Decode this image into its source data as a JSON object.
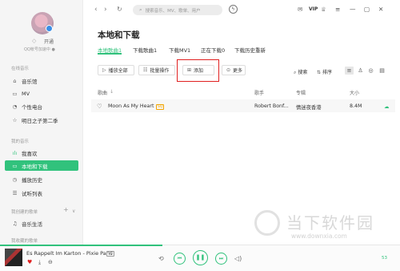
{
  "user": {
    "vip_open": "开通",
    "qq_hint": "QQ帐号加速中 ●"
  },
  "sidebar": {
    "online_heading": "在线音乐",
    "online_items": [
      {
        "label": "音乐馆",
        "icon": "music-hall-icon"
      },
      {
        "label": "MV",
        "icon": "mv-icon"
      },
      {
        "label": "个性电台",
        "icon": "radio-icon"
      },
      {
        "label": "明日之子第二季",
        "icon": "star-icon"
      }
    ],
    "my_heading": "我的音乐",
    "my_items": [
      {
        "label": "我喜欢",
        "icon": "love-chart-icon"
      },
      {
        "label": "本地和下载",
        "icon": "local-download-icon",
        "active": true
      },
      {
        "label": "播放历史",
        "icon": "history-icon"
      },
      {
        "label": "试听列表",
        "icon": "playlist-icon"
      }
    ],
    "created_heading": "我创建的歌单",
    "created_items": [
      {
        "label": "音乐生活",
        "icon": "playlist-music-icon"
      }
    ],
    "collected_heading": "我收藏的歌单"
  },
  "topbar": {
    "search_placeholder": "搜索音乐、MV、歌单、用户",
    "vip_label": "VIP"
  },
  "main": {
    "title": "本地和下载",
    "tabs": [
      {
        "label": "本地歌曲1",
        "active": true
      },
      {
        "label": "下载歌曲1"
      },
      {
        "label": "下载MV1"
      },
      {
        "label": "正在下载0"
      },
      {
        "label": "下载历史重新"
      }
    ],
    "actions": {
      "play_all": "播放全部",
      "batch": "批量操作",
      "add": "添加",
      "more": "更多",
      "search": "搜索",
      "sort": "排序"
    },
    "columns": {
      "song": "歌曲",
      "singer": "歌手",
      "album": "专辑",
      "size": "大小"
    },
    "rows": [
      {
        "song": "Moon As My Heart",
        "badge": "SQ",
        "singer": "Robert Bonf...",
        "album": "情迷夜香港",
        "size": "8.4M"
      }
    ]
  },
  "player": {
    "song": "Es Rappelt Im Karton",
    "separator": "-",
    "artist": "Pixie Paris",
    "badge": "SQ",
    "progress": 0.406,
    "time": "53"
  },
  "watermark": {
    "cn": "当下软件园",
    "url": "www.downxia.com"
  },
  "colors": {
    "accent": "#31c27c",
    "highlight_box": "#e02020"
  }
}
